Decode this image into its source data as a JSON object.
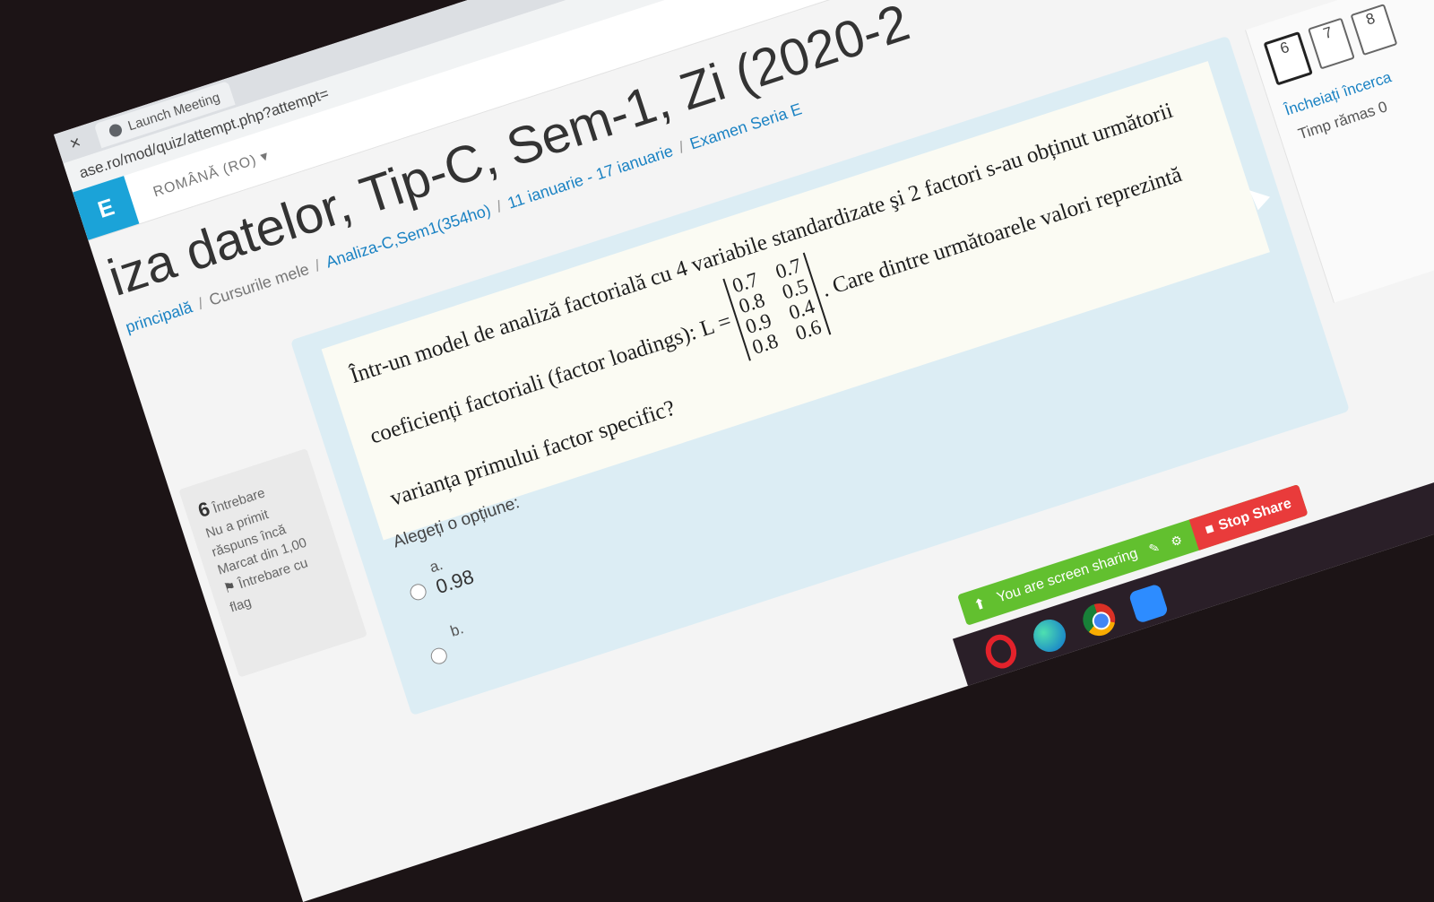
{
  "browser": {
    "tab_title": "Launch Meeting",
    "tab_close": "×",
    "url": "ase.ro/mod/quiz/attempt.php?attempt="
  },
  "header": {
    "logo": "E",
    "language": "ROMÂNĂ (RO)"
  },
  "page": {
    "heading": "iza datelor, Tip-C, Sem-1, Zi (2020-2",
    "breadcrumb": [
      "principală",
      "Cursurile mele",
      "Analiza-C,Sem1(354ho)",
      "11 ianuarie - 17 ianuarie",
      "Examen Seria E"
    ]
  },
  "question_info": {
    "number": "6",
    "label": "Întrebare",
    "status": "Nu a primit răspuns încă",
    "marks": "Marcat din 1,00",
    "flag": "Întrebare cu flag"
  },
  "question": {
    "text_before": "Într-un model de analiză factorială cu 4 variabile standardizate şi 2 factori s-au obținut următorii coeficienți factoriali (factor loadings): L =",
    "text_after": ". Care dintre următoarele valori reprezintă varianța primului factor specific?",
    "matrix": [
      [
        "0.7",
        "0.7"
      ],
      [
        "0.8",
        "0.5"
      ],
      [
        "0.9",
        "0.4"
      ],
      [
        "0.8",
        "0.6"
      ]
    ],
    "choose_label": "Alegeți o opțiune:",
    "options": [
      {
        "letter": "a.",
        "value": "0.98"
      },
      {
        "letter": "b.",
        "value": ""
      }
    ]
  },
  "quiz_nav": {
    "boxes": [
      "6",
      "7",
      "8"
    ],
    "finish_link": "Încheiați încerca",
    "time_left": "Timp rămas 0"
  },
  "share_bar": {
    "message": "You are screen sharing",
    "stop_label": "Stop Share"
  }
}
